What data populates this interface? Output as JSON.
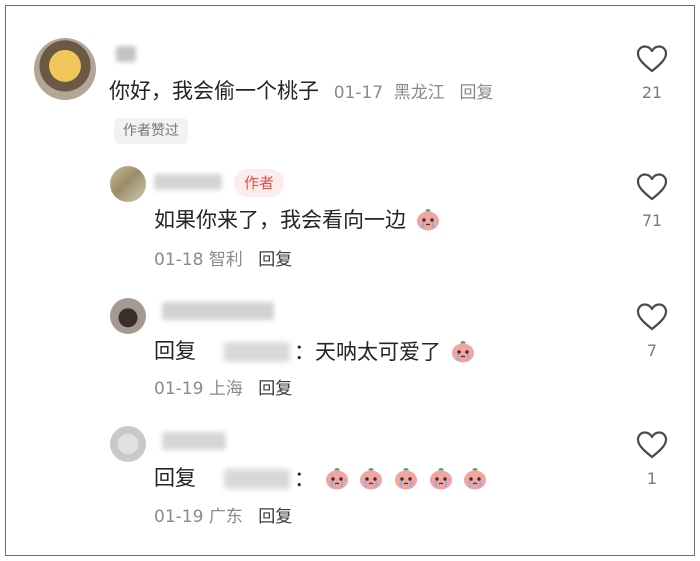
{
  "comments": [
    {
      "text": "你好，我会偷一个桃子",
      "date": "01-17",
      "location": "黑龙江",
      "reply_label": "回复",
      "badge": "作者赞过",
      "likes": "21"
    }
  ],
  "replies": [
    {
      "author_tag": "作者",
      "text": "如果你来了，我会看向一边",
      "date": "01-18",
      "location": "智利",
      "reply_label": "回复",
      "likes": "71"
    },
    {
      "prefix": "回复",
      "text": "：天呐太可爱了",
      "date": "01-19",
      "location": "上海",
      "reply_label": "回复",
      "likes": "7"
    },
    {
      "prefix": "回复",
      "text": "：",
      "date": "01-19",
      "location": "广东",
      "reply_label": "回复",
      "likes": "1"
    }
  ],
  "icons": {
    "like": "heart-outline-icon",
    "emoji": "crying-peach-icon"
  },
  "colors": {
    "author_tag": "#e8504a",
    "meta_text": "#8a8a8a"
  }
}
